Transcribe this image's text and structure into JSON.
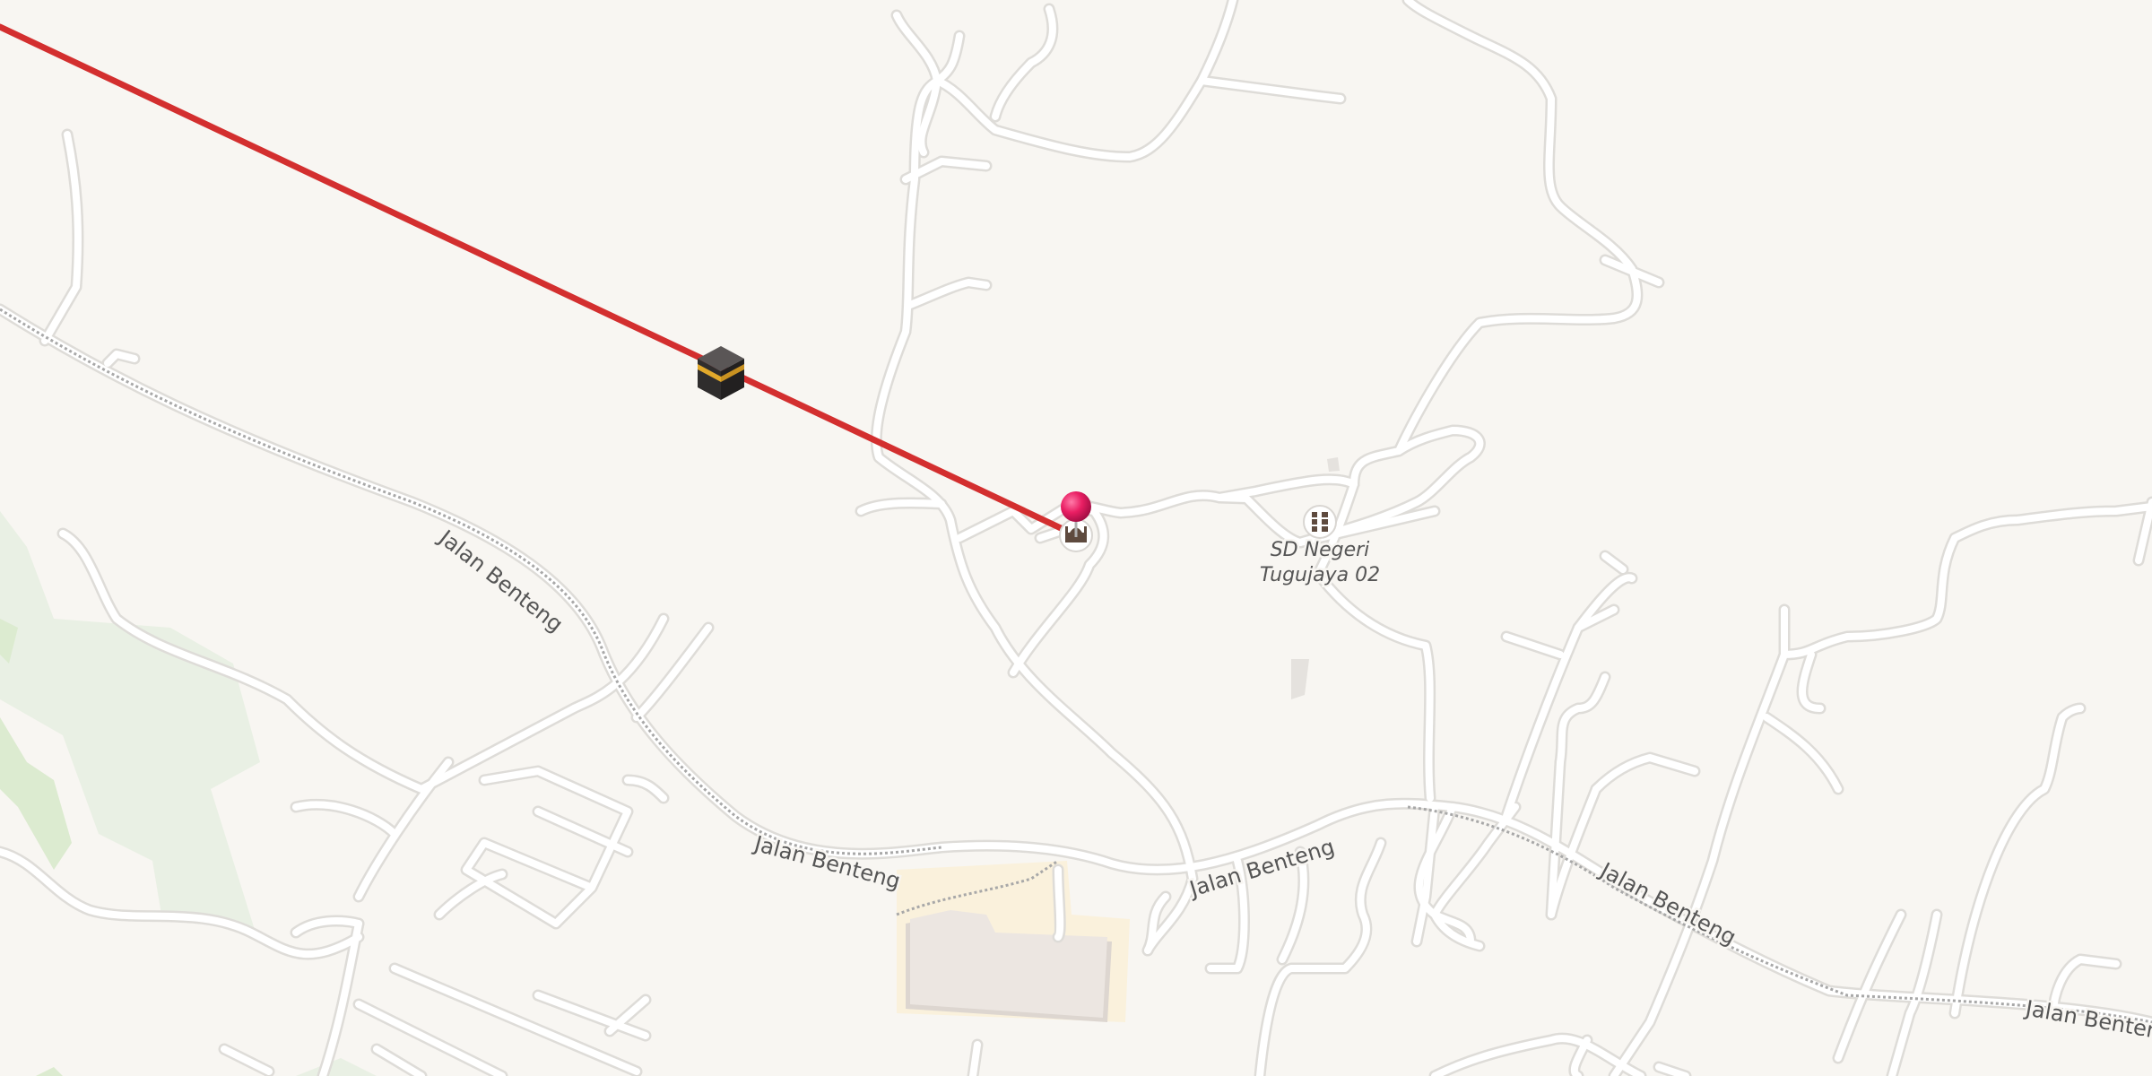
{
  "map": {
    "streets": [
      {
        "label": "Jalan Benteng"
      },
      {
        "label": "Jalan Benteng"
      },
      {
        "label": "Jalan Benteng"
      },
      {
        "label": "Jalan Benteng"
      },
      {
        "label": "Jalan Benteng"
      }
    ],
    "poi": {
      "label_line1": "SD Negeri",
      "label_line2": "Tugujaya 02",
      "icon": "school-icon"
    },
    "mosque_icon": "mosque-icon",
    "kaaba_icon": "kaaba-icon",
    "location_pin": "location-pin-icon",
    "qibla_line_color": "#d32f2f",
    "pin_color": "#e91e63",
    "background_color": "#f8f6f2",
    "park_color": "#e3eedb"
  }
}
